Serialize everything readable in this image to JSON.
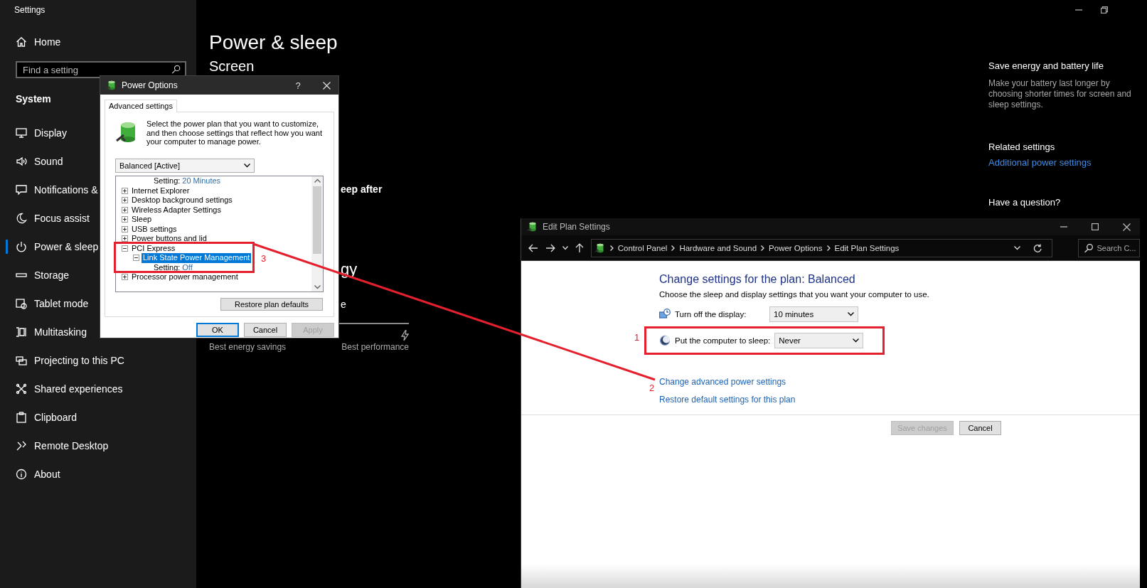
{
  "settings_window": {
    "title": "Settings"
  },
  "sidebar": {
    "home": "Home",
    "search": {
      "placeholder": "Find a setting"
    },
    "section": "System",
    "items": [
      {
        "label": "Display",
        "selected": false
      },
      {
        "label": "Sound",
        "selected": false
      },
      {
        "label": "Notifications &",
        "selected": false
      },
      {
        "label": "Focus assist",
        "selected": false
      },
      {
        "label": "Power & sleep",
        "selected": true
      },
      {
        "label": "Storage",
        "selected": false
      },
      {
        "label": "Tablet mode",
        "selected": false
      },
      {
        "label": "Multitasking",
        "selected": false
      },
      {
        "label": "Projecting to this PC",
        "selected": false
      },
      {
        "label": "Shared experiences",
        "selected": false
      },
      {
        "label": "Clipboard",
        "selected": false
      },
      {
        "label": "Remote Desktop",
        "selected": false
      },
      {
        "label": "About",
        "selected": false
      }
    ]
  },
  "main": {
    "title": "Power & sleep",
    "section": "Screen",
    "fragments": [
      {
        "kind": "label",
        "text": "eep after"
      },
      {
        "kind": "heading",
        "text": "gy"
      },
      {
        "kind": "text",
        "text": "e"
      }
    ],
    "slider": {
      "min_label": "Best energy savings",
      "max_label": "Best performance"
    }
  },
  "aside": {
    "heading": "Save energy and battery life",
    "text": "Make your battery last longer by choosing shorter times for screen and sleep settings.",
    "related_heading": "Related settings",
    "related_link": "Additional power settings",
    "question_heading": "Have a question?"
  },
  "power_options_dialog": {
    "title": "Power Options",
    "help": "?",
    "tabs": [
      {
        "label": "Advanced settings",
        "selected": true
      }
    ],
    "description": "Select the power plan that you want to customize, and then choose settings that reflect how you want your computer to manage power.",
    "plan_select": {
      "value": "Balanced [Active]"
    },
    "scrolled_setting": {
      "label": "Setting:",
      "value": "20 Minutes"
    },
    "tree": [
      {
        "kind": "group",
        "label": "Internet Explorer",
        "expanded": false,
        "selected": false,
        "highlighted": false
      },
      {
        "kind": "group",
        "label": "Desktop background settings",
        "expanded": false,
        "selected": false,
        "highlighted": false
      },
      {
        "kind": "group",
        "label": "Wireless Adapter Settings",
        "expanded": false,
        "selected": false,
        "highlighted": false
      },
      {
        "kind": "group",
        "label": "Sleep",
        "expanded": false,
        "selected": false,
        "highlighted": false
      },
      {
        "kind": "group",
        "label": "USB settings",
        "expanded": false,
        "selected": false,
        "highlighted": false
      },
      {
        "kind": "group",
        "label": "Power buttons and lid",
        "expanded": false,
        "selected": false,
        "highlighted": false
      },
      {
        "kind": "group",
        "label": "PCI Express",
        "expanded": true,
        "selected": false,
        "highlighted": true,
        "annotation": "3",
        "children": [
          {
            "kind": "group",
            "label": "Link State Power Management",
            "expanded": true,
            "selected": true,
            "highlighted": false,
            "children": [
              {
                "kind": "setting",
                "label": "Setting:",
                "value": "Off"
              }
            ]
          }
        ]
      },
      {
        "kind": "group",
        "label": "Processor power management",
        "expanded": false,
        "selected": false,
        "highlighted": false
      }
    ],
    "restore_button": "Restore plan defaults",
    "buttons": [
      {
        "label": "OK",
        "default": true,
        "disabled": false
      },
      {
        "label": "Cancel",
        "default": false,
        "disabled": false
      },
      {
        "label": "Apply",
        "default": false,
        "disabled": true
      }
    ]
  },
  "edit_plan_window": {
    "title": "Edit Plan Settings",
    "breadcrumbs": [
      "Control Panel",
      "Hardware and Sound",
      "Power Options",
      "Edit Plan Settings"
    ],
    "search": {
      "placeholder": "Search C..."
    },
    "heading": "Change settings for the plan: Balanced",
    "subtitle": "Choose the sleep and display settings that you want your computer to use.",
    "settings": [
      {
        "label": "Turn off the display:",
        "value": "10 minutes",
        "highlighted": false
      },
      {
        "label": "Put the computer to sleep:",
        "value": "Never",
        "highlighted": true,
        "annotation": "1"
      }
    ],
    "links": [
      {
        "label": "Change advanced power settings",
        "annotation": "2"
      },
      {
        "label": "Restore default settings for this plan"
      }
    ],
    "buttons": [
      {
        "label": "Save changes",
        "disabled": true
      },
      {
        "label": "Cancel",
        "disabled": false
      }
    ]
  }
}
